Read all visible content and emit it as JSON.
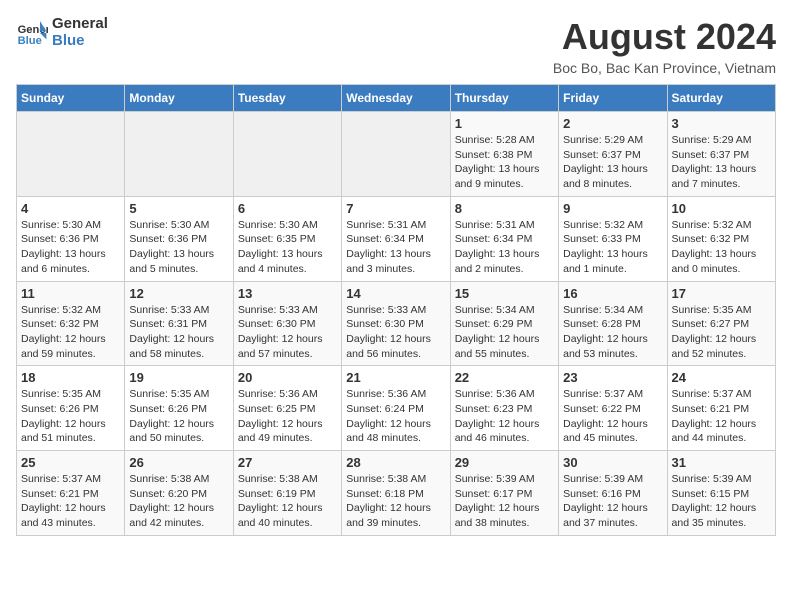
{
  "logo": {
    "name": "General",
    "name2": "Blue"
  },
  "title": "August 2024",
  "subtitle": "Boc Bo, Bac Kan Province, Vietnam",
  "days_of_week": [
    "Sunday",
    "Monday",
    "Tuesday",
    "Wednesday",
    "Thursday",
    "Friday",
    "Saturday"
  ],
  "weeks": [
    [
      {
        "day": "",
        "info": ""
      },
      {
        "day": "",
        "info": ""
      },
      {
        "day": "",
        "info": ""
      },
      {
        "day": "",
        "info": ""
      },
      {
        "day": "1",
        "info": "Sunrise: 5:28 AM\nSunset: 6:38 PM\nDaylight: 13 hours\nand 9 minutes."
      },
      {
        "day": "2",
        "info": "Sunrise: 5:29 AM\nSunset: 6:37 PM\nDaylight: 13 hours\nand 8 minutes."
      },
      {
        "day": "3",
        "info": "Sunrise: 5:29 AM\nSunset: 6:37 PM\nDaylight: 13 hours\nand 7 minutes."
      }
    ],
    [
      {
        "day": "4",
        "info": "Sunrise: 5:30 AM\nSunset: 6:36 PM\nDaylight: 13 hours\nand 6 minutes."
      },
      {
        "day": "5",
        "info": "Sunrise: 5:30 AM\nSunset: 6:36 PM\nDaylight: 13 hours\nand 5 minutes."
      },
      {
        "day": "6",
        "info": "Sunrise: 5:30 AM\nSunset: 6:35 PM\nDaylight: 13 hours\nand 4 minutes."
      },
      {
        "day": "7",
        "info": "Sunrise: 5:31 AM\nSunset: 6:34 PM\nDaylight: 13 hours\nand 3 minutes."
      },
      {
        "day": "8",
        "info": "Sunrise: 5:31 AM\nSunset: 6:34 PM\nDaylight: 13 hours\nand 2 minutes."
      },
      {
        "day": "9",
        "info": "Sunrise: 5:32 AM\nSunset: 6:33 PM\nDaylight: 13 hours\nand 1 minute."
      },
      {
        "day": "10",
        "info": "Sunrise: 5:32 AM\nSunset: 6:32 PM\nDaylight: 13 hours\nand 0 minutes."
      }
    ],
    [
      {
        "day": "11",
        "info": "Sunrise: 5:32 AM\nSunset: 6:32 PM\nDaylight: 12 hours\nand 59 minutes."
      },
      {
        "day": "12",
        "info": "Sunrise: 5:33 AM\nSunset: 6:31 PM\nDaylight: 12 hours\nand 58 minutes."
      },
      {
        "day": "13",
        "info": "Sunrise: 5:33 AM\nSunset: 6:30 PM\nDaylight: 12 hours\nand 57 minutes."
      },
      {
        "day": "14",
        "info": "Sunrise: 5:33 AM\nSunset: 6:30 PM\nDaylight: 12 hours\nand 56 minutes."
      },
      {
        "day": "15",
        "info": "Sunrise: 5:34 AM\nSunset: 6:29 PM\nDaylight: 12 hours\nand 55 minutes."
      },
      {
        "day": "16",
        "info": "Sunrise: 5:34 AM\nSunset: 6:28 PM\nDaylight: 12 hours\nand 53 minutes."
      },
      {
        "day": "17",
        "info": "Sunrise: 5:35 AM\nSunset: 6:27 PM\nDaylight: 12 hours\nand 52 minutes."
      }
    ],
    [
      {
        "day": "18",
        "info": "Sunrise: 5:35 AM\nSunset: 6:26 PM\nDaylight: 12 hours\nand 51 minutes."
      },
      {
        "day": "19",
        "info": "Sunrise: 5:35 AM\nSunset: 6:26 PM\nDaylight: 12 hours\nand 50 minutes."
      },
      {
        "day": "20",
        "info": "Sunrise: 5:36 AM\nSunset: 6:25 PM\nDaylight: 12 hours\nand 49 minutes."
      },
      {
        "day": "21",
        "info": "Sunrise: 5:36 AM\nSunset: 6:24 PM\nDaylight: 12 hours\nand 48 minutes."
      },
      {
        "day": "22",
        "info": "Sunrise: 5:36 AM\nSunset: 6:23 PM\nDaylight: 12 hours\nand 46 minutes."
      },
      {
        "day": "23",
        "info": "Sunrise: 5:37 AM\nSunset: 6:22 PM\nDaylight: 12 hours\nand 45 minutes."
      },
      {
        "day": "24",
        "info": "Sunrise: 5:37 AM\nSunset: 6:21 PM\nDaylight: 12 hours\nand 44 minutes."
      }
    ],
    [
      {
        "day": "25",
        "info": "Sunrise: 5:37 AM\nSunset: 6:21 PM\nDaylight: 12 hours\nand 43 minutes."
      },
      {
        "day": "26",
        "info": "Sunrise: 5:38 AM\nSunset: 6:20 PM\nDaylight: 12 hours\nand 42 minutes."
      },
      {
        "day": "27",
        "info": "Sunrise: 5:38 AM\nSunset: 6:19 PM\nDaylight: 12 hours\nand 40 minutes."
      },
      {
        "day": "28",
        "info": "Sunrise: 5:38 AM\nSunset: 6:18 PM\nDaylight: 12 hours\nand 39 minutes."
      },
      {
        "day": "29",
        "info": "Sunrise: 5:39 AM\nSunset: 6:17 PM\nDaylight: 12 hours\nand 38 minutes."
      },
      {
        "day": "30",
        "info": "Sunrise: 5:39 AM\nSunset: 6:16 PM\nDaylight: 12 hours\nand 37 minutes."
      },
      {
        "day": "31",
        "info": "Sunrise: 5:39 AM\nSunset: 6:15 PM\nDaylight: 12 hours\nand 35 minutes."
      }
    ]
  ]
}
